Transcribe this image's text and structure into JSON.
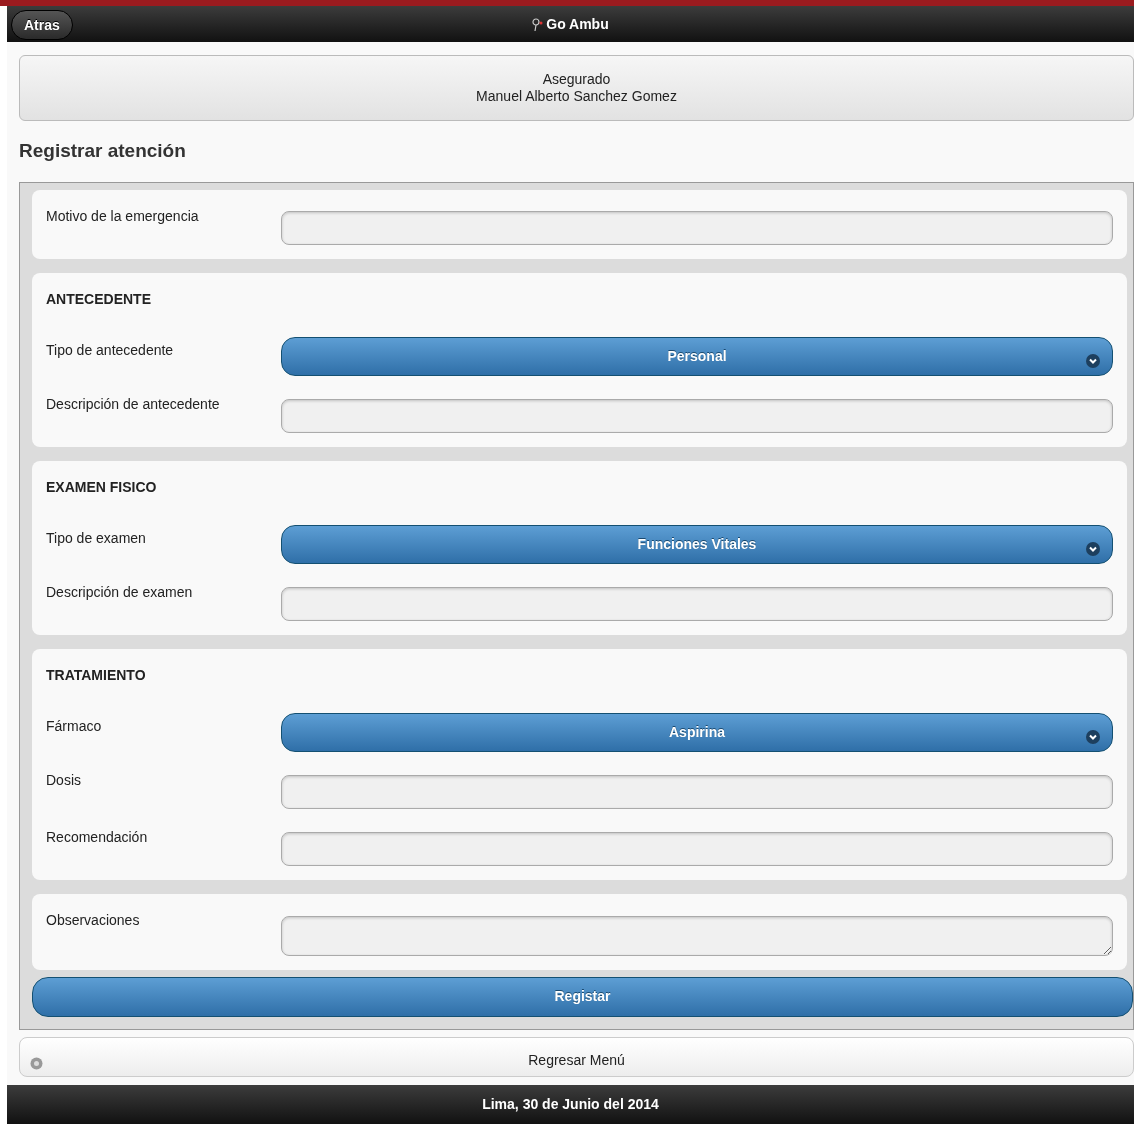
{
  "header": {
    "back_button": "Atras",
    "title": "Go Ambu"
  },
  "insured": {
    "label": "Asegurado",
    "name": "Manuel Alberto Sanchez Gomez"
  },
  "page_title": "Registrar atención",
  "sections": [
    {
      "rows": [
        {
          "kind": "input",
          "label": "Motivo de la emergencia"
        }
      ]
    },
    {
      "heading": "ANTECEDENTE",
      "rows": [
        {
          "kind": "select",
          "label": "Tipo de antecedente",
          "value": "Personal"
        },
        {
          "kind": "input",
          "label": "Descripción de antecedente"
        }
      ]
    },
    {
      "heading": "EXAMEN FISICO",
      "rows": [
        {
          "kind": "select",
          "label": "Tipo de examen",
          "value": "Funciones Vitales"
        },
        {
          "kind": "input",
          "label": "Descripción de examen"
        }
      ]
    },
    {
      "heading": "TRATAMIENTO",
      "rows": [
        {
          "kind": "select",
          "label": "Fármaco",
          "value": "Aspirina"
        },
        {
          "kind": "input",
          "label": "Dosis"
        },
        {
          "kind": "input",
          "label": "Recomendación"
        }
      ]
    },
    {
      "rows": [
        {
          "kind": "textarea",
          "label": "Observaciones"
        }
      ]
    }
  ],
  "submit_button": "Registar",
  "menu_button": "Regresar Menú",
  "footer": "Lima, 30 de Junio del 2014"
}
